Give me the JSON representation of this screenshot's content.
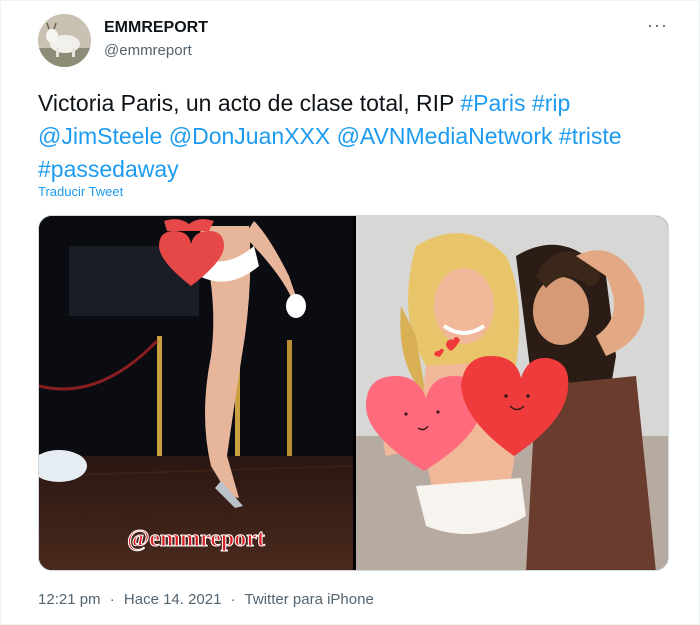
{
  "author": {
    "display_name": "EMMREPORT",
    "handle": "@emmreport",
    "avatar_icon": "goat-avatar"
  },
  "more_icon_label": "···",
  "tweet": {
    "text_plain": "Victoria Paris, un acto de clase total, RIP ",
    "tokens": [
      "#Paris",
      "#rip",
      "@JimSteele",
      "@DonJuanXXX",
      "@AVNMediaNetwork",
      "#triste",
      "#passedaway"
    ],
    "translate_label": "Traducir Tweet"
  },
  "media": {
    "left_watermark": "@emmreport"
  },
  "meta": {
    "time": "12:21 pm",
    "separator": "·",
    "date": "Hace 14. 2021",
    "source": "Twitter para iPhone"
  },
  "colors": {
    "link": "#1d9bf0",
    "text": "#0f1419",
    "secondary": "#536471"
  }
}
